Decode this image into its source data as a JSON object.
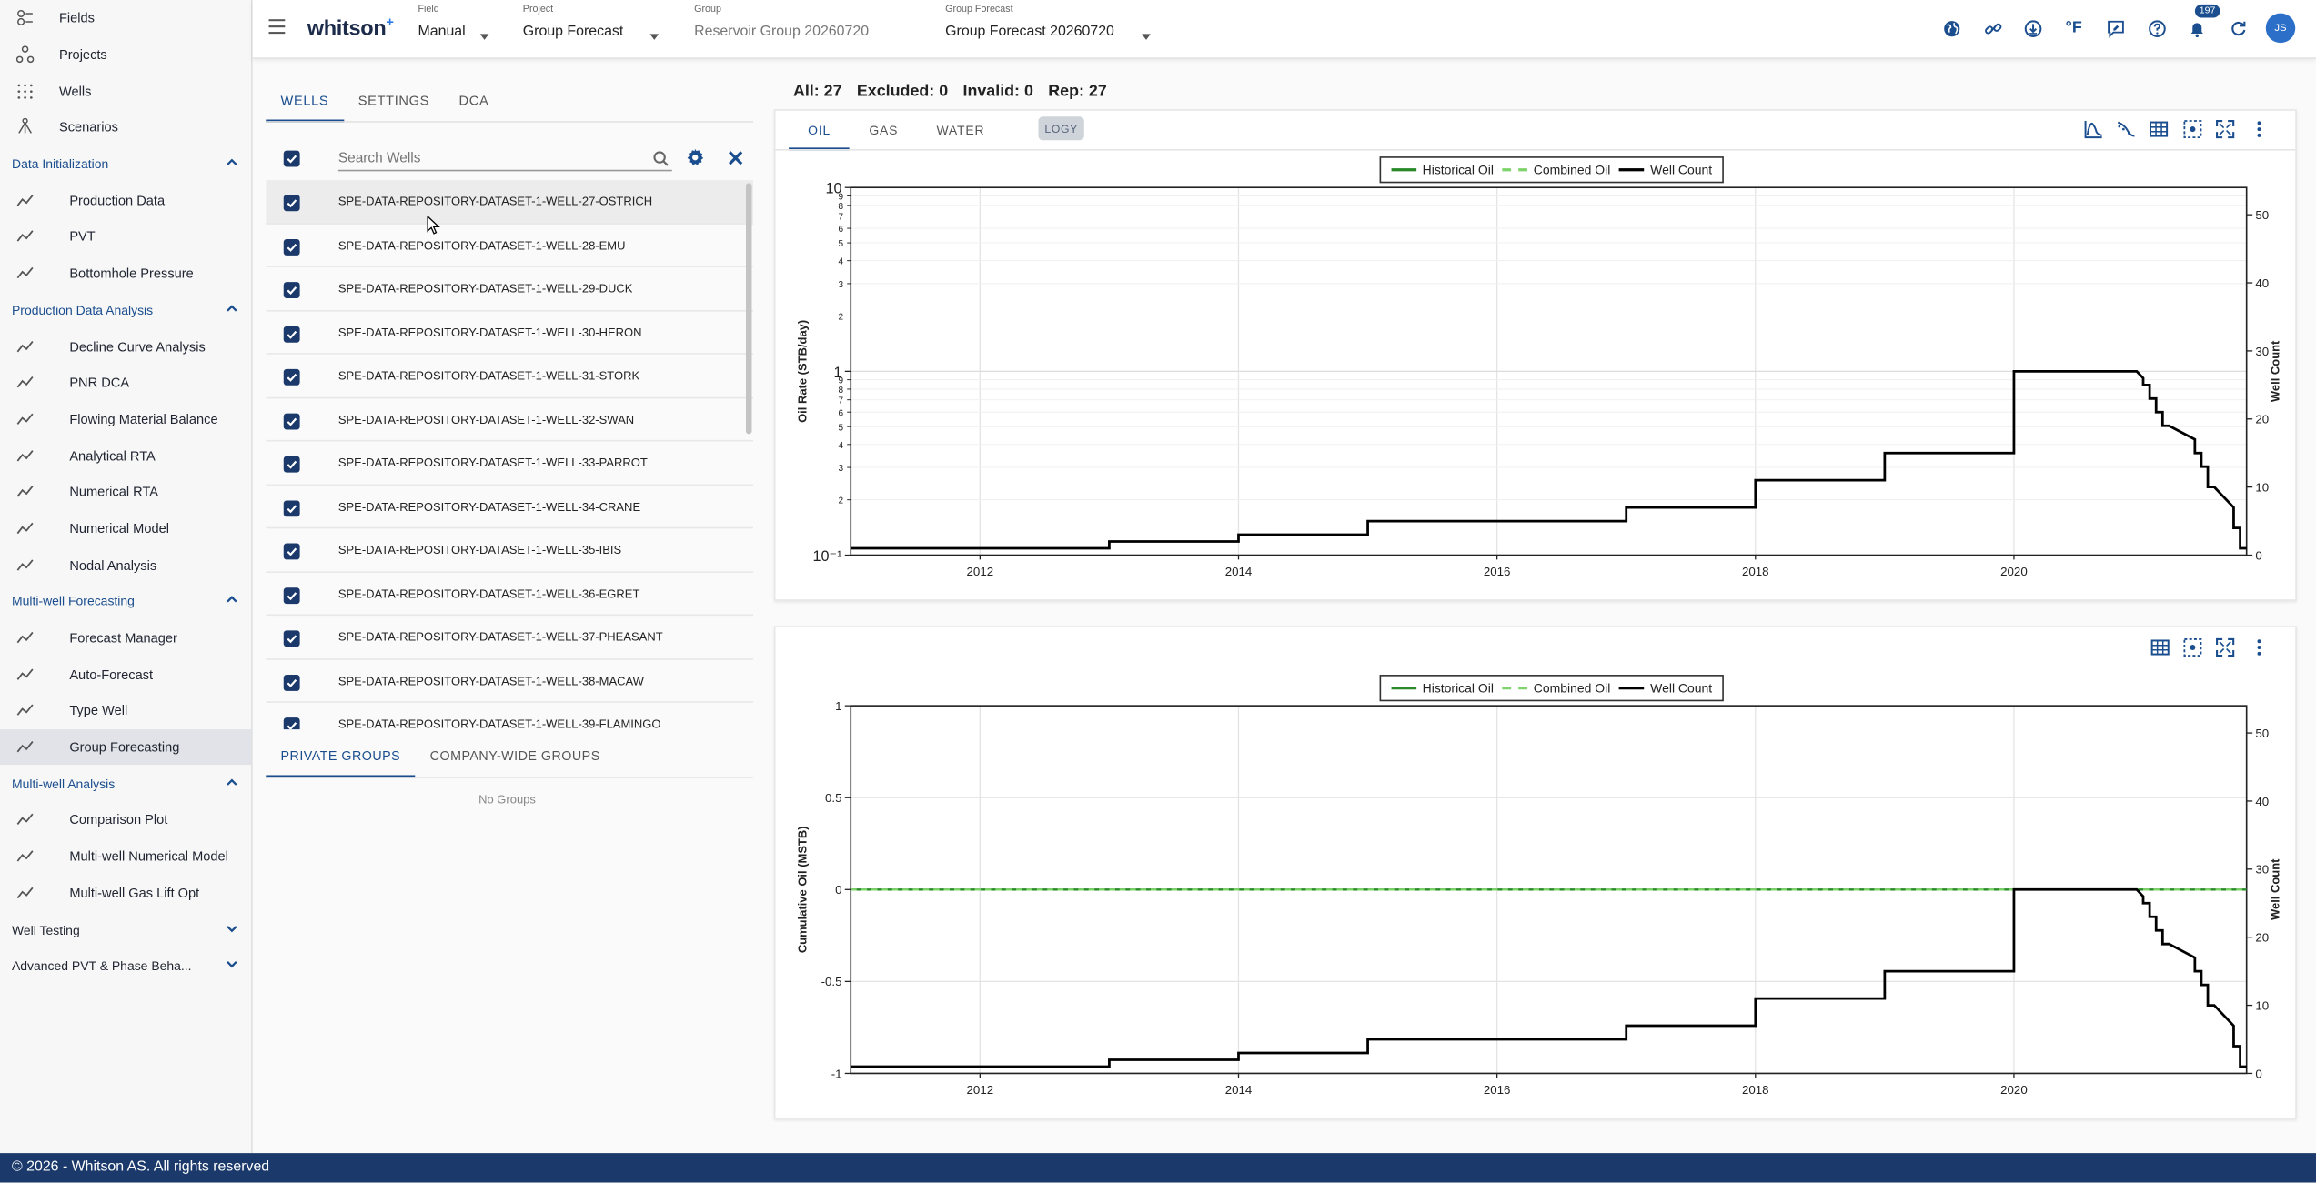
{
  "sidebar": {
    "top_items": [
      {
        "label": "Fields",
        "icon": "fields-icon"
      },
      {
        "label": "Projects",
        "icon": "projects-icon"
      },
      {
        "label": "Wells",
        "icon": "wells-icon"
      },
      {
        "label": "Scenarios",
        "icon": "scenarios-icon"
      }
    ],
    "sections": [
      {
        "title": "Data Initialization",
        "expanded": true,
        "items": [
          "Production Data",
          "PVT",
          "Bottomhole Pressure"
        ]
      },
      {
        "title": "Production Data Analysis",
        "expanded": true,
        "items": [
          "Decline Curve Analysis",
          "PNR DCA",
          "Flowing Material Balance",
          "Analytical RTA",
          "Numerical RTA",
          "Numerical Model",
          "Nodal Analysis"
        ]
      },
      {
        "title": "Multi-well Forecasting",
        "expanded": true,
        "items": [
          "Forecast Manager",
          "Auto-Forecast",
          "Type Well",
          "Group Forecasting"
        ]
      },
      {
        "title": "Multi-well Analysis",
        "expanded": true,
        "items": [
          "Comparison Plot",
          "Multi-well Numerical Model",
          "Multi-well Gas Lift Opt"
        ]
      },
      {
        "title": "Well Testing",
        "expanded": false,
        "items": []
      },
      {
        "title": "Advanced PVT & Phase Beha...",
        "expanded": false,
        "items": []
      }
    ],
    "active_item": "Group Forecasting"
  },
  "header": {
    "logo": "whitson",
    "logo_sup": "+",
    "field_caption": "Field",
    "field_value": "Manual",
    "project_caption": "Project",
    "project_value": "Group Forecast",
    "group_caption": "Group",
    "group_value": "Reservoir Group 20260720",
    "group_forecast_caption": "Group Forecast",
    "group_forecast_value": "Group Forecast 20260720",
    "notifications_count": "197",
    "avatar_initials": "JS"
  },
  "wells_panel": {
    "tabs": [
      "WELLS",
      "SETTINGS",
      "DCA"
    ],
    "active_tab": "WELLS",
    "search_placeholder": "Search Wells",
    "wells": [
      "SPE-DATA-REPOSITORY-DATASET-1-WELL-27-OSTRICH",
      "SPE-DATA-REPOSITORY-DATASET-1-WELL-28-EMU",
      "SPE-DATA-REPOSITORY-DATASET-1-WELL-29-DUCK",
      "SPE-DATA-REPOSITORY-DATASET-1-WELL-30-HERON",
      "SPE-DATA-REPOSITORY-DATASET-1-WELL-31-STORK",
      "SPE-DATA-REPOSITORY-DATASET-1-WELL-32-SWAN",
      "SPE-DATA-REPOSITORY-DATASET-1-WELL-33-PARROT",
      "SPE-DATA-REPOSITORY-DATASET-1-WELL-34-CRANE",
      "SPE-DATA-REPOSITORY-DATASET-1-WELL-35-IBIS",
      "SPE-DATA-REPOSITORY-DATASET-1-WELL-36-EGRET",
      "SPE-DATA-REPOSITORY-DATASET-1-WELL-37-PHEASANT",
      "SPE-DATA-REPOSITORY-DATASET-1-WELL-38-MACAW",
      "SPE-DATA-REPOSITORY-DATASET-1-WELL-39-FLAMINGO"
    ],
    "group_tabs": [
      "PRIVATE GROUPS",
      "COMPANY-WIDE GROUPS"
    ],
    "active_group_tab": "PRIVATE GROUPS",
    "no_groups_text": "No Groups"
  },
  "counts": {
    "all": "All: 27",
    "excluded": "Excluded: 0",
    "invalid": "Invalid: 0",
    "rep": "Rep: 27"
  },
  "fluid_tabs": [
    "OIL",
    "GAS",
    "WATER"
  ],
  "active_fluid_tab": "OIL",
  "logy_label": "LOGY",
  "colors": {
    "accent": "#1b4e8f",
    "historical": "#2a8a2a",
    "combined": "#7fd36b",
    "well_count": "#000000",
    "footer": "#1b3a6b"
  },
  "footer_text": "© 2026 - Whitson AS. All rights reserved",
  "chart_data": [
    {
      "type": "line",
      "scale": "log",
      "ylabel": "Oil Rate (STB/day)",
      "y2label": "Well Count",
      "legend": [
        "Historical Oil",
        "Combined Oil",
        "Well Count"
      ],
      "legend_placement": "top-center",
      "xlim": [
        2011.0,
        2021.8
      ],
      "ylim": [
        0.1,
        10
      ],
      "y_major_ticks": [
        "10⁻¹",
        "1",
        "10"
      ],
      "y_minor_ticks": [
        "2",
        "3",
        "4",
        "5",
        "6",
        "7",
        "8",
        "9"
      ],
      "y2lim": [
        0,
        54
      ],
      "y2_ticks": [
        0,
        10,
        20,
        30,
        40,
        50
      ],
      "x_ticks": [
        2012,
        2014,
        2016,
        2018,
        2020
      ],
      "grid": true,
      "well_count_series": {
        "name": "Well Count",
        "x": [
          2011.0,
          2013.0,
          2013.0,
          2014.0,
          2014.0,
          2015.0,
          2015.0,
          2017.0,
          2017.0,
          2018.0,
          2018.0,
          2019.0,
          2019.0,
          2020.0,
          2020.0,
          2020.95,
          2021.0,
          2021.0,
          2021.05,
          2021.05,
          2021.1,
          2021.1,
          2021.15,
          2021.15,
          2021.2,
          2021.2,
          2021.4,
          2021.4,
          2021.45,
          2021.45,
          2021.5,
          2021.5,
          2021.55,
          2021.55,
          2021.7,
          2021.7,
          2021.75,
          2021.75,
          2021.8
        ],
        "y": [
          1,
          1,
          2,
          2,
          3,
          3,
          5,
          5,
          7,
          7,
          11,
          11,
          15,
          15,
          27,
          27,
          26,
          25,
          25,
          23,
          23,
          21,
          21,
          19,
          19,
          19,
          17,
          15,
          15,
          13,
          13,
          10,
          10,
          10,
          7,
          4,
          4,
          1,
          1
        ]
      }
    },
    {
      "type": "line",
      "ylabel": "Cumulative Oil (MSTB)",
      "y2label": "Well Count",
      "legend": [
        "Historical Oil",
        "Combined Oil",
        "Well Count"
      ],
      "legend_placement": "top-center",
      "xlim": [
        2011.0,
        2021.8
      ],
      "ylim": [
        -1,
        1
      ],
      "y_ticks": [
        -1,
        -0.5,
        0,
        0.5,
        1
      ],
      "y2lim": [
        0,
        54
      ],
      "y2_ticks": [
        0,
        10,
        20,
        30,
        40,
        50
      ],
      "x_ticks": [
        2012,
        2014,
        2016,
        2018,
        2020
      ],
      "grid": true,
      "historical_oil": {
        "name": "Historical Oil",
        "x": [
          2011.0,
          2021.8
        ],
        "y": [
          0,
          0
        ]
      },
      "combined_oil": {
        "name": "Combined Oil",
        "x": [
          2011.0,
          2021.8
        ],
        "y": [
          0,
          0
        ]
      },
      "well_count_series": {
        "name": "Well Count",
        "x": [
          2011.0,
          2013.0,
          2013.0,
          2014.0,
          2014.0,
          2015.0,
          2015.0,
          2017.0,
          2017.0,
          2018.0,
          2018.0,
          2019.0,
          2019.0,
          2020.0,
          2020.0,
          2020.95,
          2021.0,
          2021.0,
          2021.05,
          2021.05,
          2021.1,
          2021.1,
          2021.15,
          2021.15,
          2021.2,
          2021.2,
          2021.4,
          2021.4,
          2021.45,
          2021.45,
          2021.5,
          2021.5,
          2021.55,
          2021.55,
          2021.7,
          2021.7,
          2021.75,
          2021.75,
          2021.8
        ],
        "y": [
          1,
          1,
          2,
          2,
          3,
          3,
          5,
          5,
          7,
          7,
          11,
          11,
          15,
          15,
          27,
          27,
          26,
          25,
          25,
          23,
          23,
          21,
          21,
          19,
          19,
          19,
          17,
          15,
          15,
          13,
          13,
          10,
          10,
          10,
          7,
          4,
          4,
          1,
          1
        ]
      }
    }
  ]
}
